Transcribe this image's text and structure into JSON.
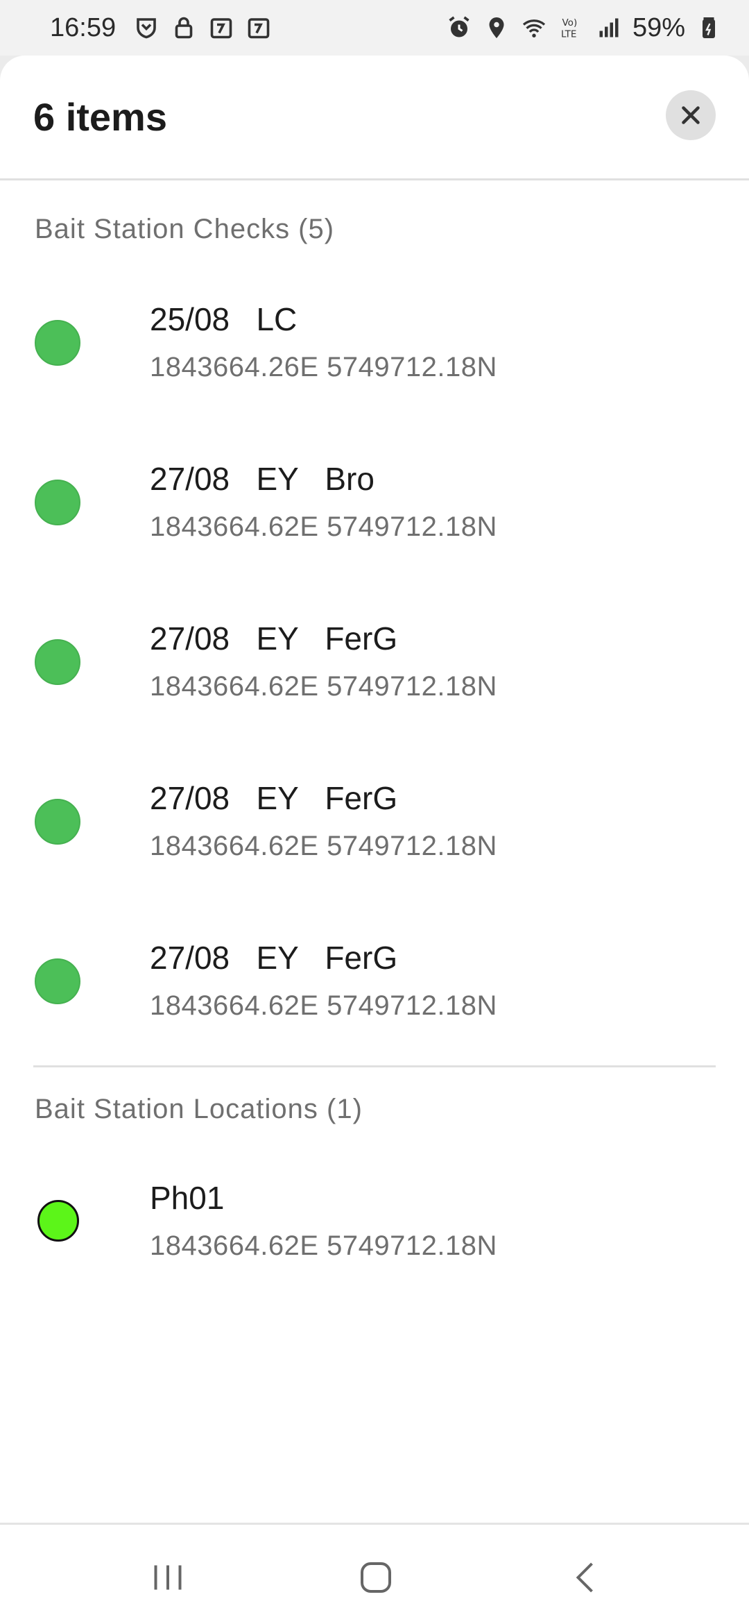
{
  "status_bar": {
    "time": "16:59",
    "battery_text": "59%",
    "left_icons": [
      "shield-icon",
      "lock-icon",
      "calendar-icon",
      "calendar-icon"
    ],
    "right_icons": [
      "alarm-icon",
      "location-icon",
      "wifi-icon",
      "volte-icon",
      "signal-icon",
      "battery-icon"
    ]
  },
  "sheet": {
    "title": "6 items",
    "close_icon": "close-icon"
  },
  "sections": [
    {
      "heading": "Bait Station Checks (5)",
      "items": [
        {
          "title": "25/08   LC",
          "subtitle": "1843664.26E 5749712.18N",
          "dot_color": "#4cbf58"
        },
        {
          "title": "27/08   EY   Bro",
          "subtitle": "1843664.62E 5749712.18N",
          "dot_color": "#4cbf58"
        },
        {
          "title": "27/08   EY   FerG",
          "subtitle": "1843664.62E 5749712.18N",
          "dot_color": "#4cbf58"
        },
        {
          "title": "27/08   EY   FerG",
          "subtitle": "1843664.62E 5749712.18N",
          "dot_color": "#4cbf58"
        },
        {
          "title": "27/08   EY   FerG",
          "subtitle": "1843664.62E 5749712.18N",
          "dot_color": "#4cbf58"
        }
      ]
    },
    {
      "heading": "Bait Station Locations (1)",
      "items": [
        {
          "title": "Ph01",
          "subtitle": "1843664.62E 5749712.18N",
          "dot_color": "#5cf519"
        }
      ]
    }
  ],
  "nav_bar": {
    "icons": [
      "recent-apps-icon",
      "home-icon",
      "back-icon"
    ]
  }
}
